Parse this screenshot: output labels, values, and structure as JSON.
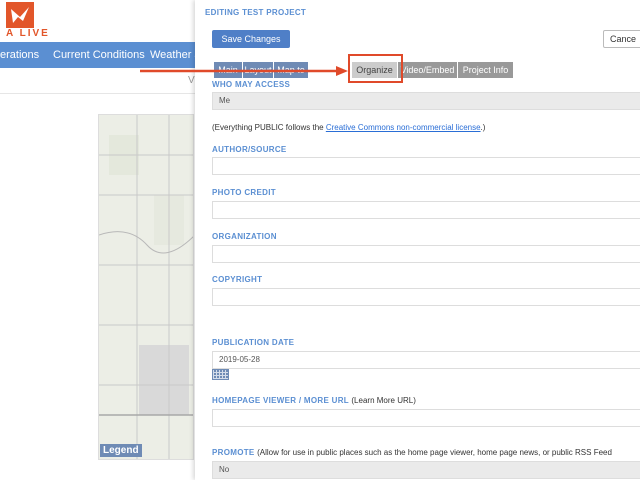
{
  "app": {
    "logo_text": "A LIVE",
    "nav_items": [
      "erations",
      "Current Conditions",
      "Weather a"
    ],
    "sub_text": "V",
    "map_legend": "Legend"
  },
  "panel": {
    "title": "EDITING TEST PROJECT",
    "save_label": "Save Changes",
    "cancel_label": "Cance",
    "tabs": [
      "Main",
      "Layout",
      "Map to",
      "Organize",
      "Video/Embed",
      "Project Info"
    ],
    "active_tab": "Organize",
    "who_may_access": {
      "label": "WHO MAY ACCESS",
      "value": "Me"
    },
    "license_note": {
      "prefix": "(Everything PUBLIC follows the ",
      "link": "Creative Commons non-commercial license",
      "suffix": ".)"
    },
    "author": {
      "label": "AUTHOR/SOURCE",
      "value": ""
    },
    "photo_credit": {
      "label": "PHOTO CREDIT",
      "value": ""
    },
    "organization": {
      "label": "ORGANIZATION",
      "value": ""
    },
    "copyright": {
      "label": "COPYRIGHT",
      "value": ""
    },
    "publication_date": {
      "label": "PUBLICATION DATE",
      "value": "2019-05-28"
    },
    "homepage": {
      "label": "HOMEPAGE VIEWER / MORE URL",
      "hint": "(Learn More URL)",
      "value": ""
    },
    "promote": {
      "label": "PROMOTE",
      "hint": "(Allow for use in public places such as the home page viewer, home page news, or public RSS Feed",
      "value": "No"
    }
  },
  "colors": {
    "accent": "#5b8fd2",
    "highlight": "#e04a2a",
    "button": "#4f7fc7"
  }
}
